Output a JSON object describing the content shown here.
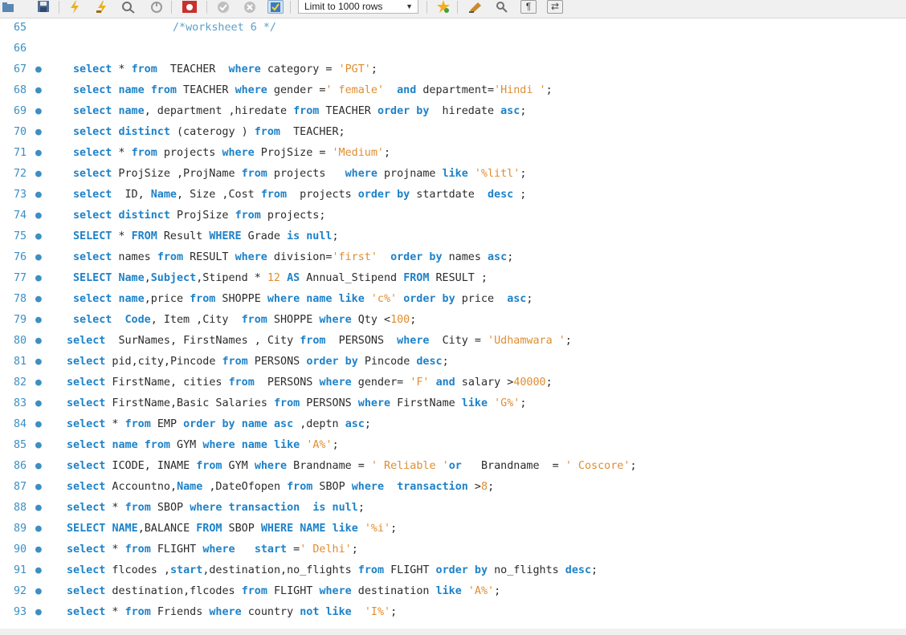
{
  "toolbar": {
    "icons": [
      "folder-icon",
      "save-icon",
      "execute-lightning-icon",
      "execute-current-icon",
      "explain-icon",
      "stop-icon",
      "toggle-error-icon",
      "commit-icon",
      "rollback-icon",
      "autocommit-icon",
      "bookmark-star-icon",
      "beautify-icon",
      "find-icon",
      "invisible-chars-icon",
      "wrap-icon"
    ],
    "limit_label": "Limit to 1000 rows"
  },
  "colors": {
    "keyword": "#1e82c8",
    "string": "#e08d30",
    "line_number": "#3b8fc4",
    "text": "#2b2b2b",
    "comment": "#5d9fc9"
  },
  "lines": [
    {
      "n": "65",
      "dot": false,
      "indent": 215,
      "tokens": [
        [
          "cm",
          "/*worksheet 6 */"
        ]
      ]
    },
    {
      "n": "66",
      "dot": false,
      "indent": 91,
      "tokens": []
    },
    {
      "n": "67",
      "dot": true,
      "indent": 91,
      "tokens": [
        [
          "kw",
          "select"
        ],
        [
          "p",
          " * "
        ],
        [
          "kw",
          "from"
        ],
        [
          "p",
          "  TEACHER  "
        ],
        [
          "kw",
          "where"
        ],
        [
          "p",
          " category = "
        ],
        [
          "str",
          "'PGT'"
        ],
        [
          "p",
          ";"
        ]
      ]
    },
    {
      "n": "68",
      "dot": true,
      "indent": 91,
      "tokens": [
        [
          "kw",
          "select"
        ],
        [
          "p",
          " "
        ],
        [
          "kw",
          "name"
        ],
        [
          "p",
          " "
        ],
        [
          "kw",
          "from"
        ],
        [
          "p",
          " TEACHER "
        ],
        [
          "kw",
          "where"
        ],
        [
          "p",
          " gender ="
        ],
        [
          "str",
          "' female'"
        ],
        [
          "p",
          "  "
        ],
        [
          "kw",
          "and"
        ],
        [
          "p",
          " department="
        ],
        [
          "str",
          "'Hindi '"
        ],
        [
          "p",
          ";"
        ]
      ]
    },
    {
      "n": "69",
      "dot": true,
      "indent": 91,
      "tokens": [
        [
          "kw",
          "select"
        ],
        [
          "p",
          " "
        ],
        [
          "kw",
          "name"
        ],
        [
          "p",
          ", department ,hiredate "
        ],
        [
          "kw",
          "from"
        ],
        [
          "p",
          " TEACHER "
        ],
        [
          "kw",
          "order by"
        ],
        [
          "p",
          "  hiredate "
        ],
        [
          "kw",
          "asc"
        ],
        [
          "p",
          ";"
        ]
      ]
    },
    {
      "n": "70",
      "dot": true,
      "indent": 91,
      "tokens": [
        [
          "kw",
          "select"
        ],
        [
          "p",
          " "
        ],
        [
          "kw",
          "distinct"
        ],
        [
          "p",
          " (caterogy ) "
        ],
        [
          "kw",
          "from"
        ],
        [
          "p",
          "  TEACHER;"
        ]
      ]
    },
    {
      "n": "71",
      "dot": true,
      "indent": 91,
      "tokens": [
        [
          "kw",
          "select"
        ],
        [
          "p",
          " * "
        ],
        [
          "kw",
          "from"
        ],
        [
          "p",
          " projects "
        ],
        [
          "kw",
          "where"
        ],
        [
          "p",
          " ProjSize = "
        ],
        [
          "str",
          "'Medium'"
        ],
        [
          "p",
          ";"
        ]
      ]
    },
    {
      "n": "72",
      "dot": true,
      "indent": 91,
      "tokens": [
        [
          "kw",
          "select"
        ],
        [
          "p",
          " ProjSize ,ProjName "
        ],
        [
          "kw",
          "from"
        ],
        [
          "p",
          " projects   "
        ],
        [
          "kw",
          "where"
        ],
        [
          "p",
          " projname "
        ],
        [
          "kw",
          "like"
        ],
        [
          "p",
          " "
        ],
        [
          "str",
          "'%litl'"
        ],
        [
          "p",
          ";"
        ]
      ]
    },
    {
      "n": "73",
      "dot": true,
      "indent": 91,
      "tokens": [
        [
          "kw",
          "select"
        ],
        [
          "p",
          "  ID, "
        ],
        [
          "kw",
          "Name"
        ],
        [
          "p",
          ", Size ,Cost "
        ],
        [
          "kw",
          "from"
        ],
        [
          "p",
          "  projects "
        ],
        [
          "kw",
          "order by"
        ],
        [
          "p",
          " startdate  "
        ],
        [
          "kw",
          "desc"
        ],
        [
          "p",
          " ;"
        ]
      ]
    },
    {
      "n": "74",
      "dot": true,
      "indent": 91,
      "tokens": [
        [
          "kw",
          "select"
        ],
        [
          "p",
          " "
        ],
        [
          "kw",
          "distinct"
        ],
        [
          "p",
          " ProjSize "
        ],
        [
          "kw",
          "from"
        ],
        [
          "p",
          " projects;"
        ]
      ]
    },
    {
      "n": "75",
      "dot": true,
      "indent": 91,
      "tokens": [
        [
          "kw",
          "SELECT"
        ],
        [
          "p",
          " * "
        ],
        [
          "kw",
          "FROM"
        ],
        [
          "p",
          " Result "
        ],
        [
          "kw",
          "WHERE"
        ],
        [
          "p",
          " Grade "
        ],
        [
          "kw",
          "is null"
        ],
        [
          "p",
          ";"
        ]
      ]
    },
    {
      "n": "76",
      "dot": true,
      "indent": 91,
      "tokens": [
        [
          "kw",
          "select"
        ],
        [
          "p",
          " names "
        ],
        [
          "kw",
          "from"
        ],
        [
          "p",
          " RESULT "
        ],
        [
          "kw",
          "where"
        ],
        [
          "p",
          " division="
        ],
        [
          "str",
          "'first'"
        ],
        [
          "p",
          "  "
        ],
        [
          "kw",
          "order by"
        ],
        [
          "p",
          " names "
        ],
        [
          "kw",
          "asc"
        ],
        [
          "p",
          ";"
        ]
      ]
    },
    {
      "n": "77",
      "dot": true,
      "indent": 91,
      "tokens": [
        [
          "kw",
          "SELECT"
        ],
        [
          "p",
          " "
        ],
        [
          "kw",
          "Name"
        ],
        [
          "p",
          ","
        ],
        [
          "kw",
          "Subject"
        ],
        [
          "p",
          ",Stipend * "
        ],
        [
          "num",
          "12"
        ],
        [
          "p",
          " "
        ],
        [
          "kw",
          "AS"
        ],
        [
          "p",
          " Annual_Stipend "
        ],
        [
          "kw",
          "FROM"
        ],
        [
          "p",
          " RESULT ;"
        ]
      ]
    },
    {
      "n": "78",
      "dot": true,
      "indent": 91,
      "tokens": [
        [
          "kw",
          "select"
        ],
        [
          "p",
          " "
        ],
        [
          "kw",
          "name"
        ],
        [
          "p",
          ",price "
        ],
        [
          "kw",
          "from"
        ],
        [
          "p",
          " SHOPPE "
        ],
        [
          "kw",
          "where"
        ],
        [
          "p",
          " "
        ],
        [
          "kw",
          "name"
        ],
        [
          "p",
          " "
        ],
        [
          "kw",
          "like"
        ],
        [
          "p",
          " "
        ],
        [
          "str",
          "'c%'"
        ],
        [
          "p",
          " "
        ],
        [
          "kw",
          "order by"
        ],
        [
          "p",
          " price  "
        ],
        [
          "kw",
          "asc"
        ],
        [
          "p",
          ";"
        ]
      ]
    },
    {
      "n": "79",
      "dot": true,
      "indent": 91,
      "tokens": [
        [
          "kw",
          "select"
        ],
        [
          "p",
          "  "
        ],
        [
          "kw",
          "Code"
        ],
        [
          "p",
          ", Item ,City  "
        ],
        [
          "kw",
          "from"
        ],
        [
          "p",
          " SHOPPE "
        ],
        [
          "kw",
          "where"
        ],
        [
          "p",
          " Qty <"
        ],
        [
          "num",
          "100"
        ],
        [
          "p",
          ";"
        ]
      ]
    },
    {
      "n": "80",
      "dot": true,
      "indent": 83,
      "tokens": [
        [
          "kw",
          "select"
        ],
        [
          "p",
          "  SurNames, FirstNames , City "
        ],
        [
          "kw",
          "from"
        ],
        [
          "p",
          "  PERSONS  "
        ],
        [
          "kw",
          "where"
        ],
        [
          "p",
          "  City = "
        ],
        [
          "str",
          "'Udhamwara '"
        ],
        [
          "p",
          ";"
        ]
      ]
    },
    {
      "n": "81",
      "dot": true,
      "indent": 83,
      "tokens": [
        [
          "kw",
          "select"
        ],
        [
          "p",
          " pid,city,Pincode "
        ],
        [
          "kw",
          "from"
        ],
        [
          "p",
          " PERSONS "
        ],
        [
          "kw",
          "order by"
        ],
        [
          "p",
          " Pincode "
        ],
        [
          "kw",
          "desc"
        ],
        [
          "p",
          ";"
        ]
      ]
    },
    {
      "n": "82",
      "dot": true,
      "indent": 83,
      "tokens": [
        [
          "kw",
          "select"
        ],
        [
          "p",
          " FirstName, cities "
        ],
        [
          "kw",
          "from"
        ],
        [
          "p",
          "  PERSONS "
        ],
        [
          "kw",
          "where"
        ],
        [
          "p",
          " gender= "
        ],
        [
          "str",
          "'F'"
        ],
        [
          "p",
          " "
        ],
        [
          "kw",
          "and"
        ],
        [
          "p",
          " salary >"
        ],
        [
          "num",
          "40000"
        ],
        [
          "p",
          ";"
        ]
      ]
    },
    {
      "n": "83",
      "dot": true,
      "indent": 83,
      "tokens": [
        [
          "kw",
          "select"
        ],
        [
          "p",
          " FirstName,Basic Salaries "
        ],
        [
          "kw",
          "from"
        ],
        [
          "p",
          " PERSONS "
        ],
        [
          "kw",
          "where"
        ],
        [
          "p",
          " FirstName "
        ],
        [
          "kw",
          "like"
        ],
        [
          "p",
          " "
        ],
        [
          "str",
          "'G%'"
        ],
        [
          "p",
          ";"
        ]
      ]
    },
    {
      "n": "84",
      "dot": true,
      "indent": 83,
      "tokens": [
        [
          "kw",
          "select"
        ],
        [
          "p",
          " * "
        ],
        [
          "kw",
          "from"
        ],
        [
          "p",
          " EMP "
        ],
        [
          "kw",
          "order by"
        ],
        [
          "p",
          " "
        ],
        [
          "kw",
          "name"
        ],
        [
          "p",
          " "
        ],
        [
          "kw",
          "asc"
        ],
        [
          "p",
          " ,deptn "
        ],
        [
          "kw",
          "asc"
        ],
        [
          "p",
          ";"
        ]
      ]
    },
    {
      "n": "85",
      "dot": true,
      "indent": 83,
      "tokens": [
        [
          "kw",
          "select"
        ],
        [
          "p",
          " "
        ],
        [
          "kw",
          "name"
        ],
        [
          "p",
          " "
        ],
        [
          "kw",
          "from"
        ],
        [
          "p",
          " GYM "
        ],
        [
          "kw",
          "where"
        ],
        [
          "p",
          " "
        ],
        [
          "kw",
          "name"
        ],
        [
          "p",
          " "
        ],
        [
          "kw",
          "like"
        ],
        [
          "p",
          " "
        ],
        [
          "str",
          "'A%'"
        ],
        [
          "p",
          ";"
        ]
      ]
    },
    {
      "n": "86",
      "dot": true,
      "indent": 83,
      "tokens": [
        [
          "kw",
          "select"
        ],
        [
          "p",
          " ICODE, INAME "
        ],
        [
          "kw",
          "from"
        ],
        [
          "p",
          " GYM "
        ],
        [
          "kw",
          "where"
        ],
        [
          "p",
          " Brandname = "
        ],
        [
          "str",
          "' Reliable '"
        ],
        [
          "kw",
          "or"
        ],
        [
          "p",
          "   Brandname  = "
        ],
        [
          "str",
          "' Coscore'"
        ],
        [
          "p",
          ";"
        ]
      ]
    },
    {
      "n": "87",
      "dot": true,
      "indent": 83,
      "tokens": [
        [
          "kw",
          "select"
        ],
        [
          "p",
          " Accountno,"
        ],
        [
          "kw",
          "Name"
        ],
        [
          "p",
          " ,DateOfopen "
        ],
        [
          "kw",
          "from"
        ],
        [
          "p",
          " SBOP "
        ],
        [
          "kw",
          "where"
        ],
        [
          "p",
          "  "
        ],
        [
          "kw",
          "transaction"
        ],
        [
          "p",
          " >"
        ],
        [
          "num",
          "8"
        ],
        [
          "p",
          ";"
        ]
      ]
    },
    {
      "n": "88",
      "dot": true,
      "indent": 83,
      "tokens": [
        [
          "kw",
          "select"
        ],
        [
          "p",
          " * "
        ],
        [
          "kw",
          "from"
        ],
        [
          "p",
          " SBOP "
        ],
        [
          "kw",
          "where"
        ],
        [
          "p",
          " "
        ],
        [
          "kw",
          "transaction"
        ],
        [
          "p",
          "  "
        ],
        [
          "kw",
          "is null"
        ],
        [
          "p",
          ";"
        ]
      ]
    },
    {
      "n": "89",
      "dot": true,
      "indent": 83,
      "tokens": [
        [
          "kw",
          "SELECT"
        ],
        [
          "p",
          " "
        ],
        [
          "kw",
          "NAME"
        ],
        [
          "p",
          ",BALANCE "
        ],
        [
          "kw",
          "FROM"
        ],
        [
          "p",
          " SBOP "
        ],
        [
          "kw",
          "WHERE"
        ],
        [
          "p",
          " "
        ],
        [
          "kw",
          "NAME"
        ],
        [
          "p",
          " "
        ],
        [
          "kw",
          "like"
        ],
        [
          "p",
          " "
        ],
        [
          "str",
          "'%i'"
        ],
        [
          "p",
          ";"
        ]
      ]
    },
    {
      "n": "90",
      "dot": true,
      "indent": 83,
      "tokens": [
        [
          "kw",
          "select"
        ],
        [
          "p",
          " * "
        ],
        [
          "kw",
          "from"
        ],
        [
          "p",
          " FLIGHT "
        ],
        [
          "kw",
          "where"
        ],
        [
          "p",
          "   "
        ],
        [
          "kw",
          "start"
        ],
        [
          "p",
          " ="
        ],
        [
          "str",
          "' Delhi'"
        ],
        [
          "p",
          ";"
        ]
      ]
    },
    {
      "n": "91",
      "dot": true,
      "indent": 83,
      "tokens": [
        [
          "kw",
          "select"
        ],
        [
          "p",
          " flcodes ,"
        ],
        [
          "kw",
          "start"
        ],
        [
          "p",
          ",destination,no_flights "
        ],
        [
          "kw",
          "from"
        ],
        [
          "p",
          " FLIGHT "
        ],
        [
          "kw",
          "order by"
        ],
        [
          "p",
          " no_flights "
        ],
        [
          "kw",
          "desc"
        ],
        [
          "p",
          ";"
        ]
      ]
    },
    {
      "n": "92",
      "dot": true,
      "indent": 83,
      "tokens": [
        [
          "kw",
          "select"
        ],
        [
          "p",
          " destination,flcodes "
        ],
        [
          "kw",
          "from"
        ],
        [
          "p",
          " FLIGHT "
        ],
        [
          "kw",
          "where"
        ],
        [
          "p",
          " destination "
        ],
        [
          "kw",
          "like"
        ],
        [
          "p",
          " "
        ],
        [
          "str",
          "'A%'"
        ],
        [
          "p",
          ";"
        ]
      ]
    },
    {
      "n": "93",
      "dot": true,
      "indent": 83,
      "tokens": [
        [
          "kw",
          "select"
        ],
        [
          "p",
          " * "
        ],
        [
          "kw",
          "from"
        ],
        [
          "p",
          " Friends "
        ],
        [
          "kw",
          "where"
        ],
        [
          "p",
          " country "
        ],
        [
          "kw",
          "not like"
        ],
        [
          "p",
          "  "
        ],
        [
          "str",
          "'I%'"
        ],
        [
          "p",
          ";"
        ]
      ]
    }
  ]
}
